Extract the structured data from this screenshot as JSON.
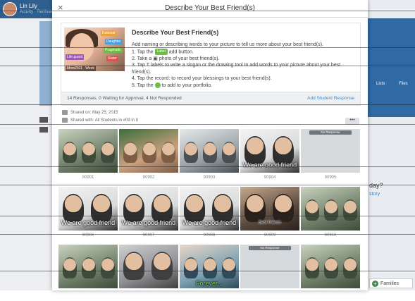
{
  "background": {
    "user_name": "Lin Lily",
    "user_sub": "Activity · Renhua",
    "right_labels": [
      "Lists",
      "Files"
    ],
    "right_text": [
      "day?",
      "story"
    ],
    "families_label": "Families"
  },
  "modal": {
    "title": "Describe Your Best Friend(s)",
    "close_icon": "×",
    "card": {
      "title": "Describe Your Best Friend(s)",
      "intro": "Add naming or describing words to your picture to tell us more about your best friend(s).",
      "steps": [
        {
          "before": "1. Tap the",
          "chip": "Label",
          "after": "add button."
        },
        {
          "before": "2. Take a",
          "chip": "",
          "after": "photo of your best friend(s)."
        },
        {
          "before": "3. Tap",
          "chip": "",
          "after": "labels to write a slogan or the drawing tool to add words to your picture about your best friend(s)."
        },
        {
          "before": "4. Tap the record: to record your blessings to your best friend(s).",
          "chip": "",
          "after": ""
        },
        {
          "before": "5. Tap the",
          "chip": "",
          "after": "to add to your portfolio."
        }
      ],
      "image_tags": [
        "Rational",
        "Daughter",
        "Pragmatic",
        "Life guard",
        "Sister"
      ],
      "image_caption": "Mom2011 · Week"
    },
    "footer": {
      "responses": "14 Responses, 0 Waiting for Approval, 4 Not Responded",
      "add_student": "Add Student Response"
    },
    "meta": {
      "shared_on": "Shared on: May 25, 2015",
      "shared_with": "Shared with: All Students in #09 in II"
    },
    "more_label": "•••",
    "no_response_label": "No Response",
    "tiles": [
      {
        "num": "90901",
        "caption": "",
        "kind": "class"
      },
      {
        "num": "90902",
        "caption": "",
        "kind": "closeup"
      },
      {
        "num": "90903",
        "caption": "",
        "kind": "group"
      },
      {
        "num": "90904",
        "caption": "We are good friend",
        "kind": "selfie"
      },
      {
        "num": "90905",
        "caption": "",
        "kind": "empty"
      },
      {
        "num": "90906",
        "caption": "We are good friend",
        "kind": "selfie"
      },
      {
        "num": "90907",
        "caption": "We are good friend",
        "kind": "selfie"
      },
      {
        "num": "90908",
        "caption": "We are good friend",
        "kind": "selfie"
      },
      {
        "num": "90909",
        "caption": "Best friends",
        "kind": "girls"
      },
      {
        "num": "90910",
        "caption": "",
        "kind": "class"
      },
      {
        "num": "",
        "caption": "",
        "kind": "class"
      },
      {
        "num": "",
        "caption": "",
        "kind": "selfie2"
      },
      {
        "num": "",
        "caption": "Forever...",
        "kind": "lovely"
      },
      {
        "num": "",
        "caption": "",
        "kind": "empty"
      },
      {
        "num": "",
        "caption": "",
        "kind": "class"
      }
    ]
  }
}
